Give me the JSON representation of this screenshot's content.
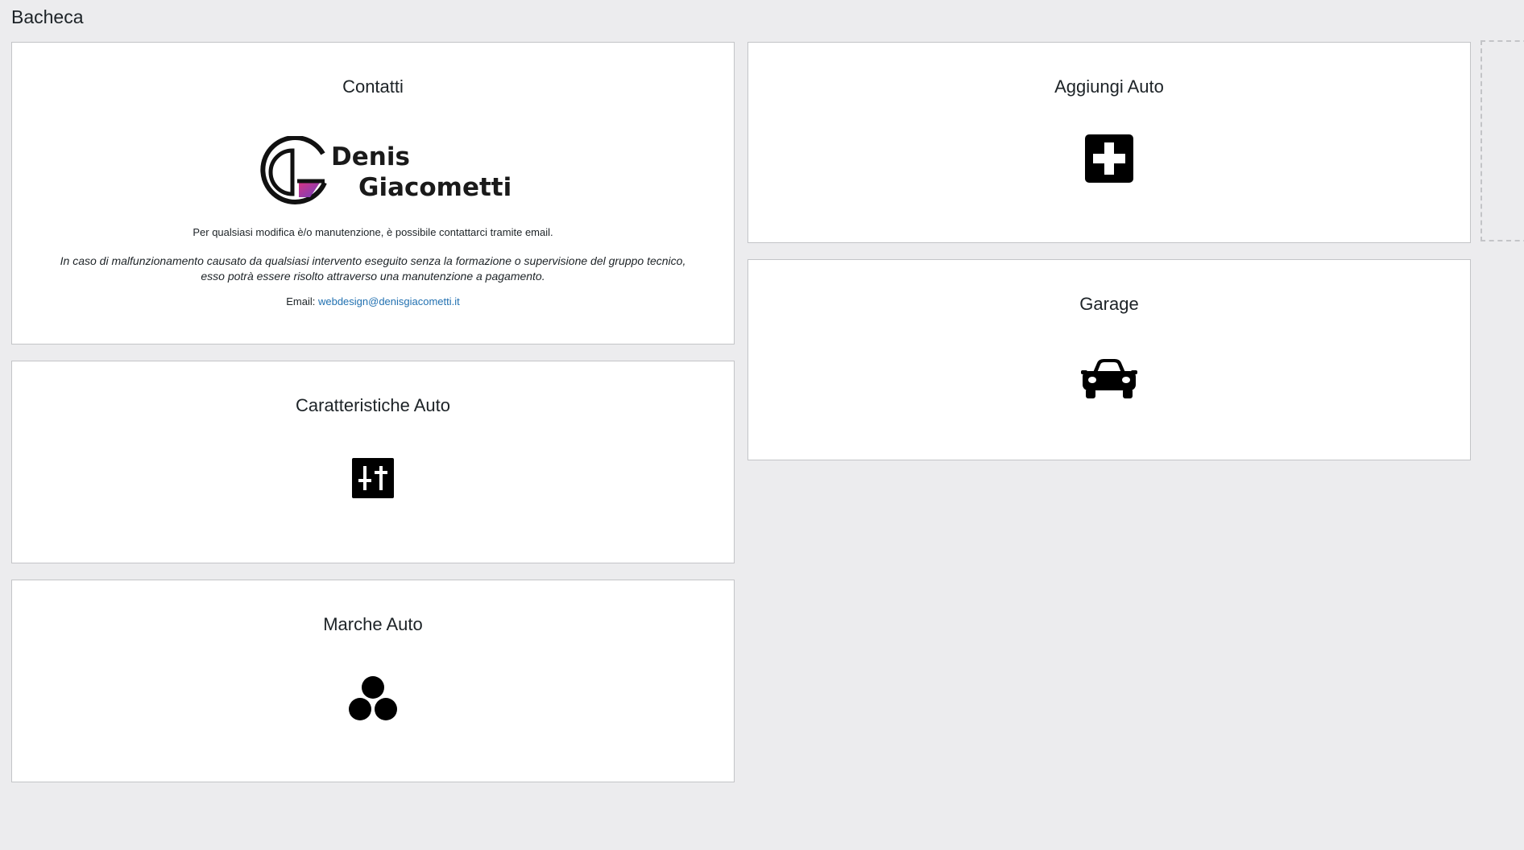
{
  "page": {
    "title": "Bacheca"
  },
  "contacts": {
    "title": "Contatti",
    "logo": {
      "line1": "Denis",
      "line2": "Giacometti"
    },
    "info": "Per qualsiasi modifica è/o manutenzione, è possibile contattarci tramite email.",
    "disclaimer_line1": "In caso di malfunzionamento causato da qualsiasi intervento eseguito senza la formazione o supervisione del gruppo tecnico,",
    "disclaimer_line2": "esso potrà essere risolto attraverso una manutenzione a pagamento.",
    "email_label": "Email:",
    "email": "webdesign@denisgiacometti.it"
  },
  "cards": {
    "caratteristiche": {
      "title": "Caratteristiche Auto",
      "icon": "sliders-icon"
    },
    "marche": {
      "title": "Marche Auto",
      "icon": "circles-icon"
    },
    "aggiungi": {
      "title": "Aggiungi Auto",
      "icon": "plus-square-icon"
    },
    "garage": {
      "title": "Garage",
      "icon": "car-icon"
    }
  },
  "colors": {
    "background": "#ececee",
    "card": "#ffffff",
    "border": "#c3c4c7",
    "link": "#2271b1",
    "logo_accent_start": "#d63384",
    "logo_accent_end": "#6f42c1"
  }
}
